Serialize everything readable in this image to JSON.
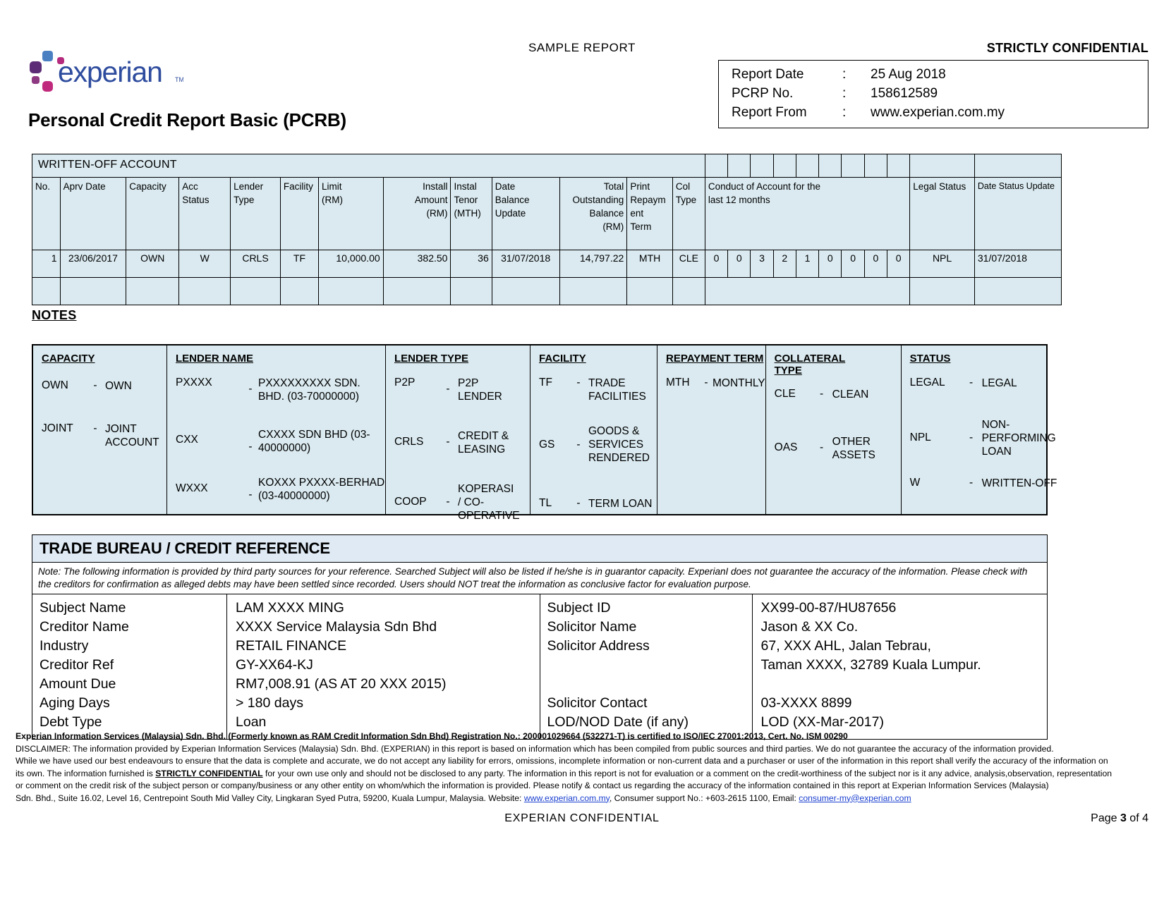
{
  "header": {
    "sample_report": "SAMPLE REPORT",
    "strictly_confidential": "STRICTLY CONFIDENTIAL",
    "logo_text": "experian",
    "logo_tm": "TM",
    "doc_title": "Personal Credit Report Basic (PCRB)",
    "info": {
      "report_date_label": "Report Date",
      "report_date_value": "25 Aug 2018",
      "pcrp_no_label": "PCRP No.",
      "pcrp_no_value": "158612589",
      "report_from_label": "Report From",
      "report_from_value": "www.experian.com.my",
      "colon": ":"
    }
  },
  "written_off": {
    "section_title": "WRITTEN-OFF ACCOUNT",
    "headers": {
      "no": "No.",
      "aprv_date": "Aprv Date",
      "capacity": "Capacity",
      "acc_status": "Acc\nStatus",
      "lender_type": "Lender\nType",
      "facility": "Facility",
      "limit": "Limit\n(RM)",
      "install_amount": "Install\nAmount\n(RM)",
      "instal_tenor": "Instal\nTenor\n(MTH)",
      "date_balance_update": "Date\nBalance\nUpdate",
      "total_outstanding": "Total\nOutstanding\nBalance\n(RM)",
      "print_repayment_term": "Print\nRepaym\nent\nTerm",
      "col_type": "Col\nType",
      "conduct": "Conduct of Account for the\nlast 12 months",
      "legal_status": "Legal Status",
      "date_status_update": "Date Status Update"
    },
    "rows": [
      {
        "no": "1",
        "aprv_date": "23/06/2017",
        "capacity": "OWN",
        "acc_status": "W",
        "lender_type": "CRLS",
        "facility": "TF",
        "limit": "10,000.00",
        "install_amount": "382.50",
        "instal_tenor": "36",
        "date_balance_update": "31/07/2018",
        "total_outstanding": "14,797.22",
        "print_repayment_term": "MTH",
        "col_type": "CLE",
        "conduct": [
          "0",
          "0",
          "3",
          "2",
          "1",
          "0",
          "0",
          "0",
          "0"
        ],
        "legal_status": "NPL",
        "date_status_update": "31/07/2018"
      }
    ]
  },
  "notes": {
    "label": "NOTES",
    "columns": [
      {
        "heading": "CAPACITY",
        "entries": [
          {
            "code": "OWN",
            "dash": "-",
            "desc": "OWN"
          },
          {
            "code": "JOINT",
            "dash": "-",
            "desc": "JOINT ACCOUNT"
          }
        ]
      },
      {
        "heading": "LENDER NAME",
        "entries": [
          {
            "code": "PXXXX",
            "dash": "-",
            "desc": "PXXXXXXXXX SDN. BHD. (03-70000000)"
          },
          {
            "code": "CXX",
            "dash": "-",
            "desc": "CXXXX SDN BHD (03-40000000)"
          },
          {
            "code": "WXXX",
            "dash": "-",
            "desc": "KOXXX  PXXXX-BERHAD (03-40000000)"
          }
        ]
      },
      {
        "heading": "LENDER TYPE",
        "entries": [
          {
            "code": "P2P",
            "dash": "-",
            "desc": "P2P LENDER"
          },
          {
            "code": "CRLS",
            "dash": "-",
            "desc": "CREDIT & LEASING"
          },
          {
            "code": "COOP",
            "dash": "-",
            "desc": "KOPERASI / CO-OPERATIVE"
          }
        ]
      },
      {
        "heading": "FACILITY",
        "entries": [
          {
            "code": "TF",
            "dash": "-",
            "desc": "TRADE FACILITIES"
          },
          {
            "code": "GS",
            "dash": "-",
            "desc": "GOODS & SERVICES RENDERED"
          },
          {
            "code": "TL",
            "dash": "-",
            "desc": "TERM LOAN"
          }
        ]
      },
      {
        "heading": "REPAYMENT TERM",
        "entries": [
          {
            "code": "MTH",
            "dash": "-",
            "desc": "MONTHLY"
          }
        ]
      },
      {
        "heading": "COLLATERAL TYPE",
        "entries": [
          {
            "code": "CLE",
            "dash": "-",
            "desc": "CLEAN"
          },
          {
            "code": "OAS",
            "dash": "-",
            "desc": "OTHER ASSETS"
          }
        ]
      },
      {
        "heading": "STATUS",
        "entries": [
          {
            "code": "LEGAL",
            "dash": "-",
            "desc": "LEGAL"
          },
          {
            "code": "NPL",
            "dash": "-",
            "desc": "NON-PERFORMING LOAN"
          },
          {
            "code": "W",
            "dash": "-",
            "desc": "WRITTEN-OFF"
          }
        ]
      }
    ]
  },
  "trade_bureau": {
    "title": "TRADE BUREAU / CREDIT REFERENCE",
    "note": "Note: The following information is provided by third party sources for your reference. Searched Subject will also be listed if he/she is in guarantor capacity. ExperianI does not guarantee the accuracy of the information. Please check with the creditors for confirmation as alleged debts may have been settled since recorded. Users should NOT treat the information as conclusive factor for evaluation purpose.",
    "left": [
      {
        "key": "Subject Name",
        "value": "LAM XXXX MING"
      },
      {
        "key": "Creditor Name",
        "value": "XXXX Service Malaysia Sdn Bhd"
      },
      {
        "key": "Industry",
        "value": "RETAIL FINANCE"
      },
      {
        "key": "Creditor Ref",
        "value": "GY-XX64-KJ"
      },
      {
        "key": "Amount Due",
        "value": "RM7,008.91 (AS AT 20 XXX 2015)"
      },
      {
        "key": "Aging Days",
        "value": "> 180 days"
      },
      {
        "key": "Debt Type",
        "value": "Loan"
      }
    ],
    "right": [
      {
        "key": "Subject ID",
        "value": "XX99-00-87/HU87656"
      },
      {
        "key": "Solicitor Name",
        "value": "Jason & XX Co."
      },
      {
        "key": "Solicitor Address",
        "value": "67, XXX AHL, Jalan Tebrau,"
      },
      {
        "key": "",
        "value": "Taman XXXX, 32789 Kuala Lumpur."
      },
      {
        "key": "",
        "value": ""
      },
      {
        "key": "Solicitor Contact",
        "value": "03-XXXX 8899"
      },
      {
        "key": "LOD/NOD Date (if any)",
        "value": "LOD (XX-Mar-2017)"
      }
    ]
  },
  "footer": {
    "registration": "Experian Information Services (Malaysia) Sdn. Bhd. (Formerly known as RAM Credit Information Sdn Bhd) Registration No.: 200001029664 (532271-T) is certified to ISO/IEC 27001:2013, Cert. No. ISM 00290",
    "disclaimer_1": "DISCLAIMER: The information provided by Experian Information Services (Malaysia) Sdn. Bhd. (EXPERIAN) in this report is based on information which has been compiled from public sources and third parties. We do not guarantee the accuracy of the information provided.",
    "disclaimer_2": "While we have used our best endeavours to ensure that the data is complete and accurate, we do not accept any liability for errors, omissions, incomplete information or non-current data and a purchaser or user of the information in this report shall verify the accuracy of the information on",
    "disclaimer_3a": "its own. The information furnished is ",
    "disclaimer_3b": "STRICTLY CONFIDENTIAL",
    "disclaimer_3c": " for your own use only and should not be disclosed to any party. The information in this report is not for evaluation or a comment on the credit-worthiness of the subject nor is it any advice, analysis,observation, representation",
    "disclaimer_4": "or comment on the credit risk of the subject person or company/business or any other entity on whom/which the information is provided. Please notify & contact us regarding the accuracy of the information contained in this report at Experian Information Services (Malaysia)",
    "disclaimer_5a": "Sdn. Bhd., Suite 16.02, Level 16, Centrepoint South Mid Valley City, Lingkaran Syed Putra, 59200, Kuala Lumpur, Malaysia. Website: ",
    "disclaimer_5_link1": "www.experian.com.my",
    "disclaimer_5b": ", Consumer support No.: +603-2615 1100, Email: ",
    "disclaimer_5_link2": "consumer-my@experian.com",
    "confidential_center": "EXPERIAN  CONFIDENTIAL",
    "page_label": "Page ",
    "page_number": "3",
    "page_of": " of 4"
  },
  "colors": {
    "table_fill": "#daeaf0",
    "section_fill": "#dfeaf5",
    "link": "#1a3fcf",
    "logo_blue": "#2e4c9e",
    "logo_magenta": "#b52c7e",
    "logo_purple": "#5c2d76",
    "logo_lightblue": "#4a7fc1"
  }
}
